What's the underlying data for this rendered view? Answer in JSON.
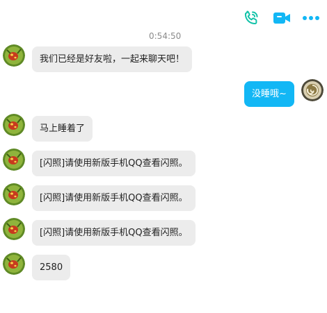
{
  "toolbar": {
    "icons": [
      "phone-icon",
      "video-call-icon",
      "more-icon"
    ],
    "accent_color": "#12b7f5",
    "phone_color": "#11c2a8"
  },
  "timestamp": "0:54:50",
  "messages": [
    {
      "side": "left",
      "text": "我们已经是好友啦，一起来聊天吧！"
    },
    {
      "side": "right",
      "text": "没睡哦~"
    },
    {
      "side": "left",
      "text": "马上睡着了"
    },
    {
      "side": "left",
      "text": "[闪照]请使用新版手机QQ查看闪照。"
    },
    {
      "side": "left",
      "text": "[闪照]请使用新版手机QQ查看闪照。"
    },
    {
      "side": "left",
      "text": "[闪照]请使用新版手机QQ查看闪照。"
    },
    {
      "side": "left",
      "text": "2580"
    }
  ],
  "colors": {
    "incoming_bubble": "#ececec",
    "outgoing_bubble": "#12b7f5"
  }
}
